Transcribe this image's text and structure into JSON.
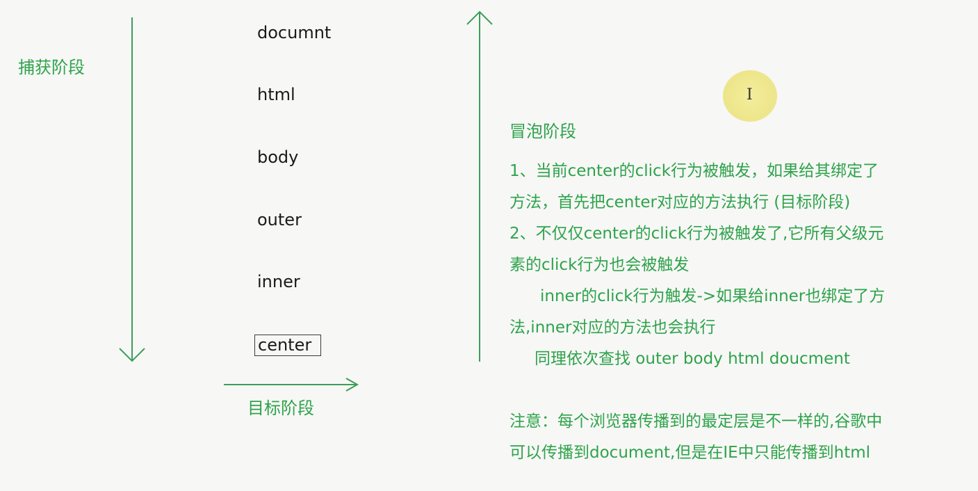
{
  "capture_phase_label": "捕获阶段",
  "target_phase_label": "目标阶段",
  "bubble_phase_label": "冒泡阶段",
  "nodes": [
    "documnt",
    "html",
    "body",
    "outer",
    "inner",
    "center"
  ],
  "notes": [
    "1、当前center的click行为被触发，如果给其绑定了",
    "方法，首先把center对应的方法执行 (目标阶段)",
    "2、不仅仅center的click行为被触发了,它所有父级元",
    "素的click行为也会被触发",
    "inner的click行为触发->如果给inner也绑定了方",
    "法,inner对应的方法也会执行",
    "同理依次查找 outer body html doucment",
    "注意：每个浏览器传播到的最定层是不一样的,谷歌中",
    "可以传播到document,但是在IE中只能传播到html"
  ],
  "colors": {
    "green_text": "#2ea34a",
    "arrow": "#3b9e5a",
    "node_text": "#1a1a1a",
    "background": "#f7f7f6",
    "cursor_highlight": "#efe68f"
  },
  "icons": {
    "cursor": "text-cursor-icon"
  }
}
